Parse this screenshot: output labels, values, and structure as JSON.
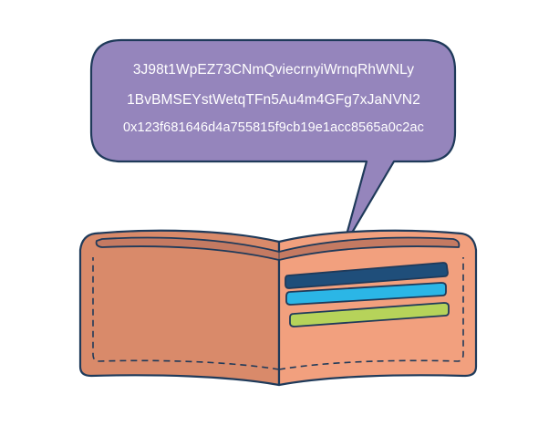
{
  "bubble": {
    "lines": [
      "3J98t1WpEZ73CNmQviecrnyiWrnqRhWNLy",
      "1BvBMSEYstWetqTFn5Au4m4GFg7xJaNVN2",
      "0x123f681646d4a755815f9cb19e1acc8565a0c2ac"
    ]
  },
  "colors": {
    "bubble_fill": "#9585bc",
    "outline": "#1f3a5a",
    "wallet_left": "#d98a6a",
    "wallet_right": "#f2a07e",
    "wallet_rim": "#c47a62",
    "card_navy": "#1f4e7a",
    "card_cyan": "#2bb6e6",
    "card_green": "#b6d35a"
  },
  "icons": {
    "wallet": "wallet-icon",
    "bubble": "speech-bubble-icon"
  }
}
